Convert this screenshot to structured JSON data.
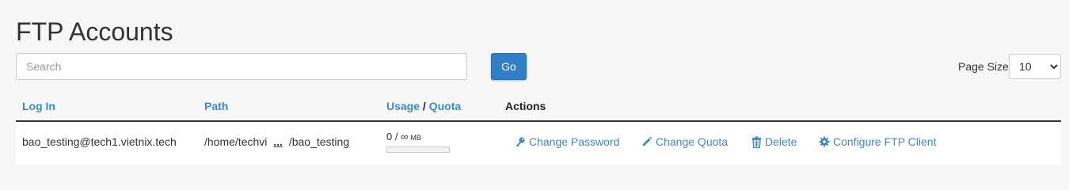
{
  "page": {
    "title": "FTP Accounts"
  },
  "search": {
    "placeholder": "Search",
    "value": ""
  },
  "go_label": "Go",
  "page_size": {
    "label": "Page Size",
    "selected": "10"
  },
  "columns": {
    "login": "Log In",
    "path": "Path",
    "usage": "Usage",
    "separator": "/",
    "quota": "Quota",
    "actions": "Actions"
  },
  "accounts": [
    {
      "login": "bao_testing@tech1.vietnix.tech",
      "path_start": "/home/techvi",
      "path_ellipsis": "...",
      "path_end": "/bao_testing",
      "usage": "0 / ∞",
      "usage_unit": "MB",
      "usage_fraction": 0,
      "actions": {
        "change_password": "Change Password",
        "change_quota": "Change Quota",
        "delete": "Delete",
        "configure": "Configure FTP Client"
      }
    }
  ],
  "icons": {
    "change_password": "key-icon",
    "change_quota": "pencil-icon",
    "delete": "trash-icon",
    "configure": "gear-icon"
  },
  "colors": {
    "accent": "#3a8bc8",
    "button": "#2f7fc9"
  }
}
